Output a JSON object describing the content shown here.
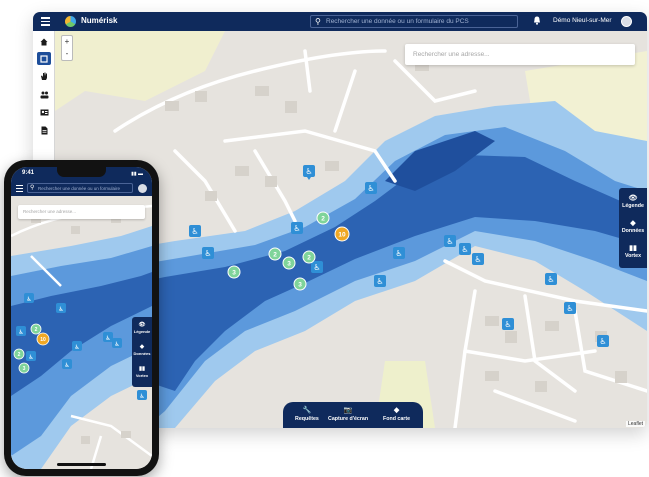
{
  "desktop": {
    "app_name": "Numérisk",
    "search_placeholder": "Rechercher une donnée ou un formulaire du PCS",
    "user_name": "Démo Nieul-sur-Mer",
    "address_placeholder": "Rechercher une adresse...",
    "zoom_in": "+",
    "zoom_out": "-",
    "side_panel": [
      {
        "label": "Légende",
        "icon": "eye-icon"
      },
      {
        "label": "Données",
        "icon": "layers-icon"
      },
      {
        "label": "Vortex",
        "icon": "chart-icon"
      }
    ],
    "bottom_bar": [
      {
        "label": "Requêtes",
        "icon": "wrench-icon"
      },
      {
        "label": "Capture d'écran",
        "icon": "camera-icon"
      },
      {
        "label": "Fond carte",
        "icon": "layers-icon"
      }
    ],
    "attribution": "Leaflet",
    "tools": [
      "home-icon",
      "map-icon",
      "hand-icon",
      "people-icon",
      "id-card-icon",
      "document-icon"
    ],
    "clusters": [
      "2",
      "10",
      "2",
      "3",
      "2",
      "3",
      "3"
    ]
  },
  "phone": {
    "time": "9:41",
    "search_placeholder": "Rechercher une donnée ou un formulaire",
    "address_placeholder": "Rechercher une adresse...",
    "side_panel": [
      {
        "label": "Légende",
        "icon": "eye-icon"
      },
      {
        "label": "Données",
        "icon": "layers-icon"
      },
      {
        "label": "Vortex",
        "icon": "chart-icon"
      }
    ],
    "clusters": [
      "2",
      "10",
      "3",
      "2"
    ]
  },
  "colors": {
    "navbar": "#0f2a5c",
    "flood_deep": "#2a60b0",
    "flood_mid": "#4f8fd8",
    "flood_light": "#8fc0ec",
    "marker": "#2f8fd6",
    "cluster_green": "#7fd49a",
    "cluster_orange": "#f0a824"
  }
}
